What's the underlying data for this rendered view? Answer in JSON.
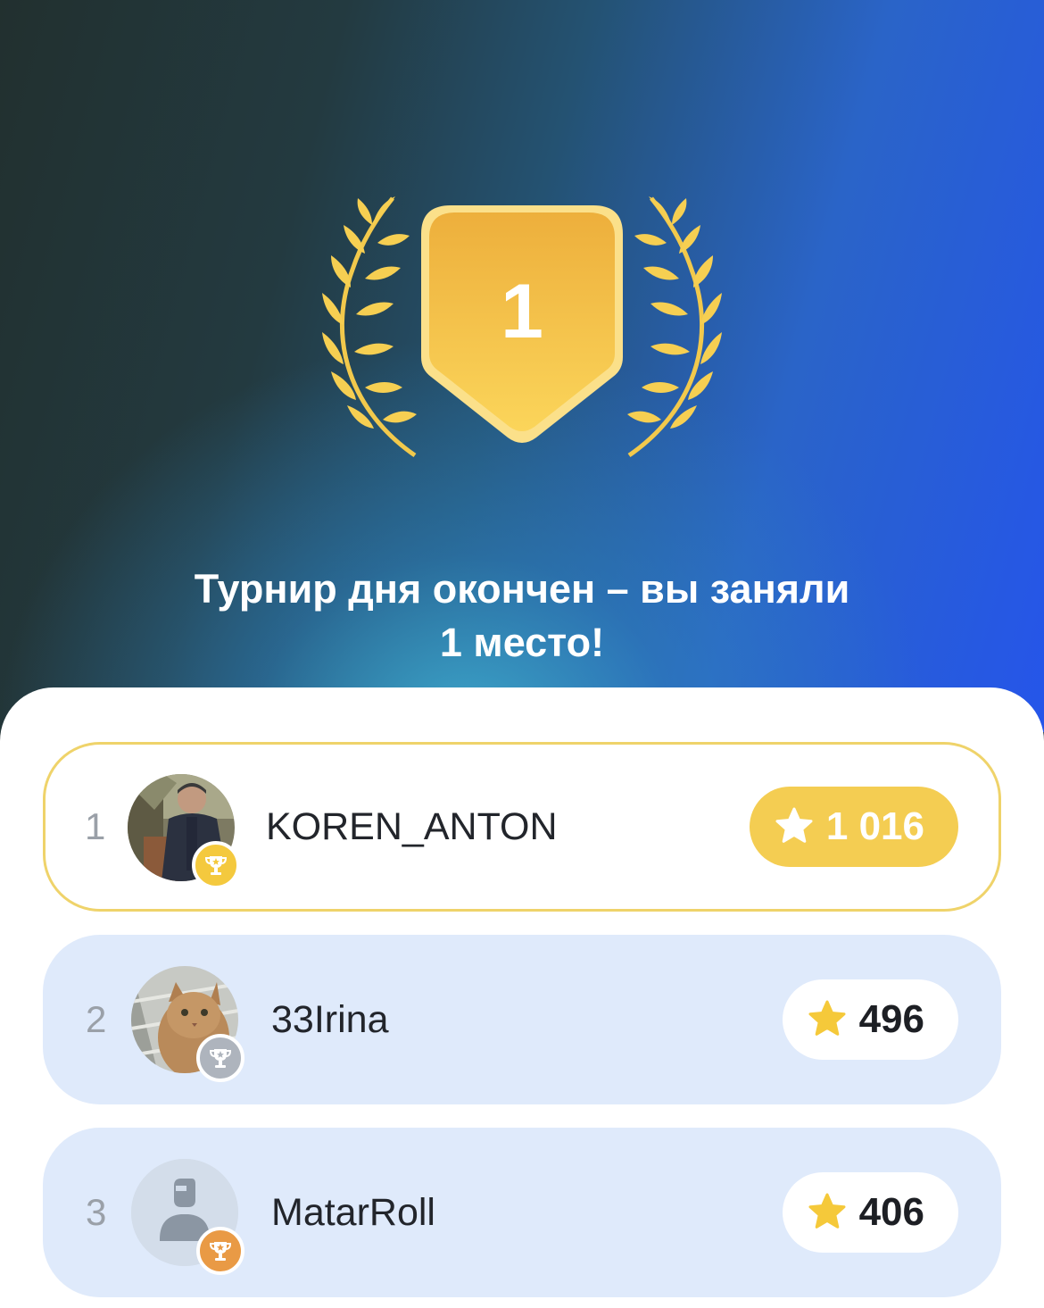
{
  "hero": {
    "place_number": "1",
    "title_line1": "Турнир дня окончен – вы заняли",
    "title_line2": "1 место!",
    "badge_icon": "gold-shield-badge-icon",
    "laurel_icon": "laurel-wreath-icon"
  },
  "colors": {
    "gold": "#F4CD52",
    "silver": "#AEB4BD",
    "bronze": "#E99A45",
    "row_bg": "#DFEAFB",
    "hero_blue": "#2555EA"
  },
  "leaderboard": [
    {
      "rank": "1",
      "username": "KOREN_ANTON",
      "score": "1 016",
      "medal": "gold",
      "avatar": "user-photo-man",
      "highlighted": true,
      "icons": {
        "medal": "trophy-icon",
        "score": "star-icon"
      }
    },
    {
      "rank": "2",
      "username": "33Irina",
      "score": "496",
      "medal": "silver",
      "avatar": "user-photo-cat",
      "highlighted": false,
      "icons": {
        "medal": "trophy-icon",
        "score": "star-icon"
      }
    },
    {
      "rank": "3",
      "username": "MatarRoll",
      "score": "406",
      "medal": "bronze",
      "avatar": "default-avatar-placeholder",
      "highlighted": false,
      "icons": {
        "medal": "trophy-icon",
        "score": "star-icon"
      }
    }
  ]
}
